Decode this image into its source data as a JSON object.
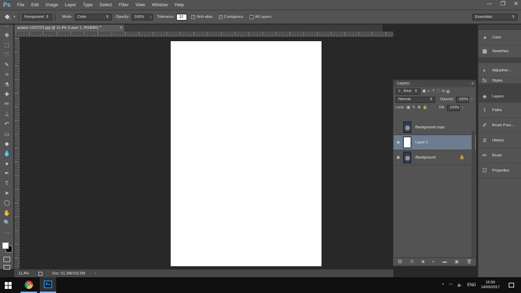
{
  "app": {
    "logo": "Ps",
    "window_controls": [
      "—",
      "❐",
      "✕"
    ]
  },
  "menu": [
    "File",
    "Edit",
    "Image",
    "Layer",
    "Type",
    "Select",
    "Filter",
    "View",
    "Window",
    "Help"
  ],
  "options_bar": {
    "tool_icon": "fill-bucket-icon",
    "source_value": "Foreground",
    "mode_label": "Mode:",
    "mode_value": "Color",
    "opacity_label": "Opacity:",
    "opacity_value": "100%",
    "tolerance_label": "Tolerance:",
    "tolerance_value": "32",
    "antialias_label": "Anti-alias",
    "antialias_checked": true,
    "contiguous_label": "Contiguous",
    "contiguous_checked": true,
    "all_layers_label": "All Layers",
    "all_layers_checked": false,
    "workspace_value": "Essentials"
  },
  "document": {
    "tab_title": "aviator-1322701.jpg @ 11.4% (Layer 1, RGB/8#) *",
    "tab_close": "×",
    "canvas_color": "#ffffff"
  },
  "status": {
    "zoom": "11.4%",
    "doc_info": "Doc: 51.3M/102.5M"
  },
  "dock": {
    "items": [
      {
        "label": "Color",
        "icon": "color-wheel-icon"
      },
      {
        "label": "Swatches",
        "icon": "swatches-grid-icon"
      },
      {
        "label": "Adjustme...",
        "icon": "adjustments-icon"
      },
      {
        "label": "Styles",
        "icon": "styles-icon"
      },
      {
        "label": "Layers",
        "icon": "layers-icon"
      },
      {
        "label": "Paths",
        "icon": "paths-icon"
      },
      {
        "label": "Brush Pres...",
        "icon": "brush-presets-icon"
      },
      {
        "label": "History",
        "icon": "history-icon"
      },
      {
        "label": "Brush",
        "icon": "brush-icon"
      },
      {
        "label": "Properties",
        "icon": "properties-icon"
      }
    ]
  },
  "layers_panel": {
    "title": "Layers",
    "filter_kind": "Kind",
    "blend_mode": "Normal",
    "opacity_label": "Opacity:",
    "opacity_value": "100%",
    "lock_label": "Lock:",
    "fill_label": "Fill:",
    "fill_value": "100%",
    "layers": [
      {
        "name": "Background copy",
        "visible": false,
        "thumb": "photo",
        "selected": false,
        "locked": false
      },
      {
        "name": "Layer 1",
        "visible": true,
        "thumb": "white",
        "selected": true,
        "locked": false
      },
      {
        "name": "Background",
        "visible": true,
        "thumb": "photo",
        "selected": false,
        "locked": true
      }
    ]
  },
  "taskbar": {
    "tray_lang": "ENG",
    "time": "16:59",
    "date": "14/09/2017"
  }
}
